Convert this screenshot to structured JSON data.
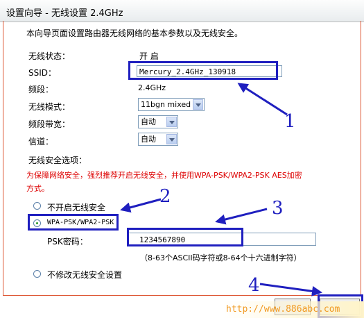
{
  "title": "设置向导 - 无线设置 2.4GHz",
  "intro": "本向导页面设置路由器无线网络的基本参数以及无线安全。",
  "fields": {
    "status_label": "无线状态：",
    "status_value": "开 启",
    "ssid_label": "SSID：",
    "ssid_value": "Mercury_2.4GHz_130918",
    "band_label": "频段：",
    "band_value": "2.4GHz",
    "mode_label": "无线模式：",
    "mode_value": "11bgn mixed",
    "width_label": "频段带宽：",
    "width_value": "自动",
    "channel_label": "信道：",
    "channel_value": "自动"
  },
  "security": {
    "heading": "无线安全选项：",
    "warning_line1": "为保障网络安全，强烈推荐开启无线安全，并使用WPA-PSK/WPA2-PSK AES加密",
    "warning_line2": "方式。",
    "option_off": "不开启无线安全",
    "option_wpa": "WPA-PSK/WPA2-PSK",
    "psk_label": "PSK密码：",
    "psk_value": "1234567890",
    "psk_hint": "（8-63个ASCII码字符或8-64个十六进制字符）",
    "option_keep": "不修改无线安全设置",
    "selected": "WPA-PSK/WPA2-PSK"
  },
  "annotations": {
    "n1": "1",
    "n2": "2",
    "n3": "3",
    "n4": "4"
  },
  "watermark": "http://www.886abc.com",
  "colors": {
    "warning": "#dd0000",
    "annotation": "#1f1fbf",
    "panel_border": "#dd5533",
    "watermark": "#f19a23"
  }
}
